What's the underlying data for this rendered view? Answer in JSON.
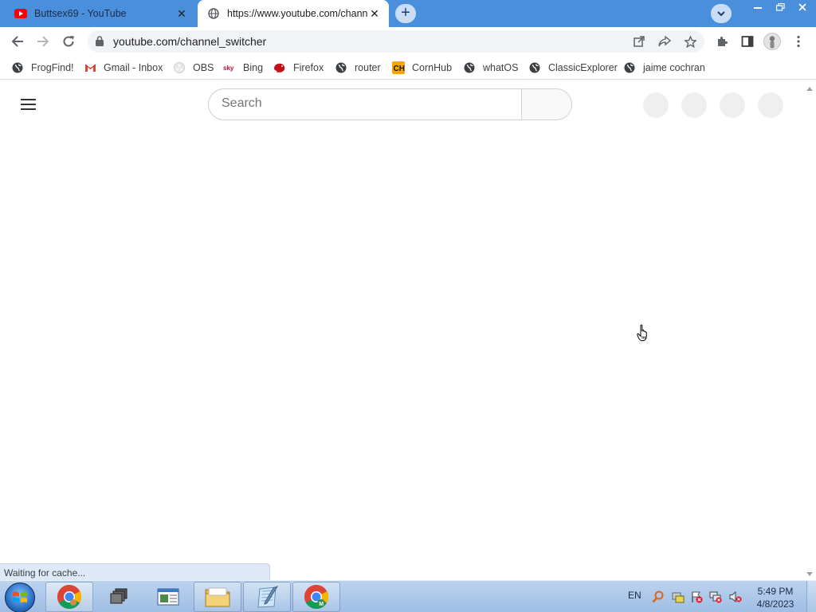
{
  "tabs": [
    {
      "title": "Buttsex69 - YouTube",
      "favicon": "youtube-icon",
      "active": false
    },
    {
      "title": "https://www.youtube.com/chann",
      "favicon": "globe-icon",
      "active": true
    }
  ],
  "toolbar": {
    "url": "youtube.com/channel_switcher"
  },
  "bookmarks": [
    {
      "label": "FrogFind!",
      "icon": "globe-icon"
    },
    {
      "label": "Gmail - Inbox",
      "icon": "gmail-icon"
    },
    {
      "label": "OBS",
      "icon": "obs-icon"
    },
    {
      "label": "Bing",
      "icon": "sky-icon"
    },
    {
      "label": "Firefox",
      "icon": "firefox-icon"
    },
    {
      "label": "router",
      "icon": "globe-icon"
    },
    {
      "label": "CornHub",
      "icon": "ch-icon"
    },
    {
      "label": "whatOS",
      "icon": "globe-icon"
    },
    {
      "label": "ClassicExplorer",
      "icon": "globe-icon"
    },
    {
      "label": "jaime cochran",
      "icon": "globe-icon"
    }
  ],
  "page": {
    "search_placeholder": "Search",
    "status_text": "Waiting for cache..."
  },
  "taskbar": {
    "language": "EN",
    "time": "5:49 PM",
    "date": "4/8/2023"
  },
  "colors": {
    "tabstrip": "#4a8fdc",
    "youtube_red": "#ff0000",
    "taskbar": "#a9c4e6"
  }
}
